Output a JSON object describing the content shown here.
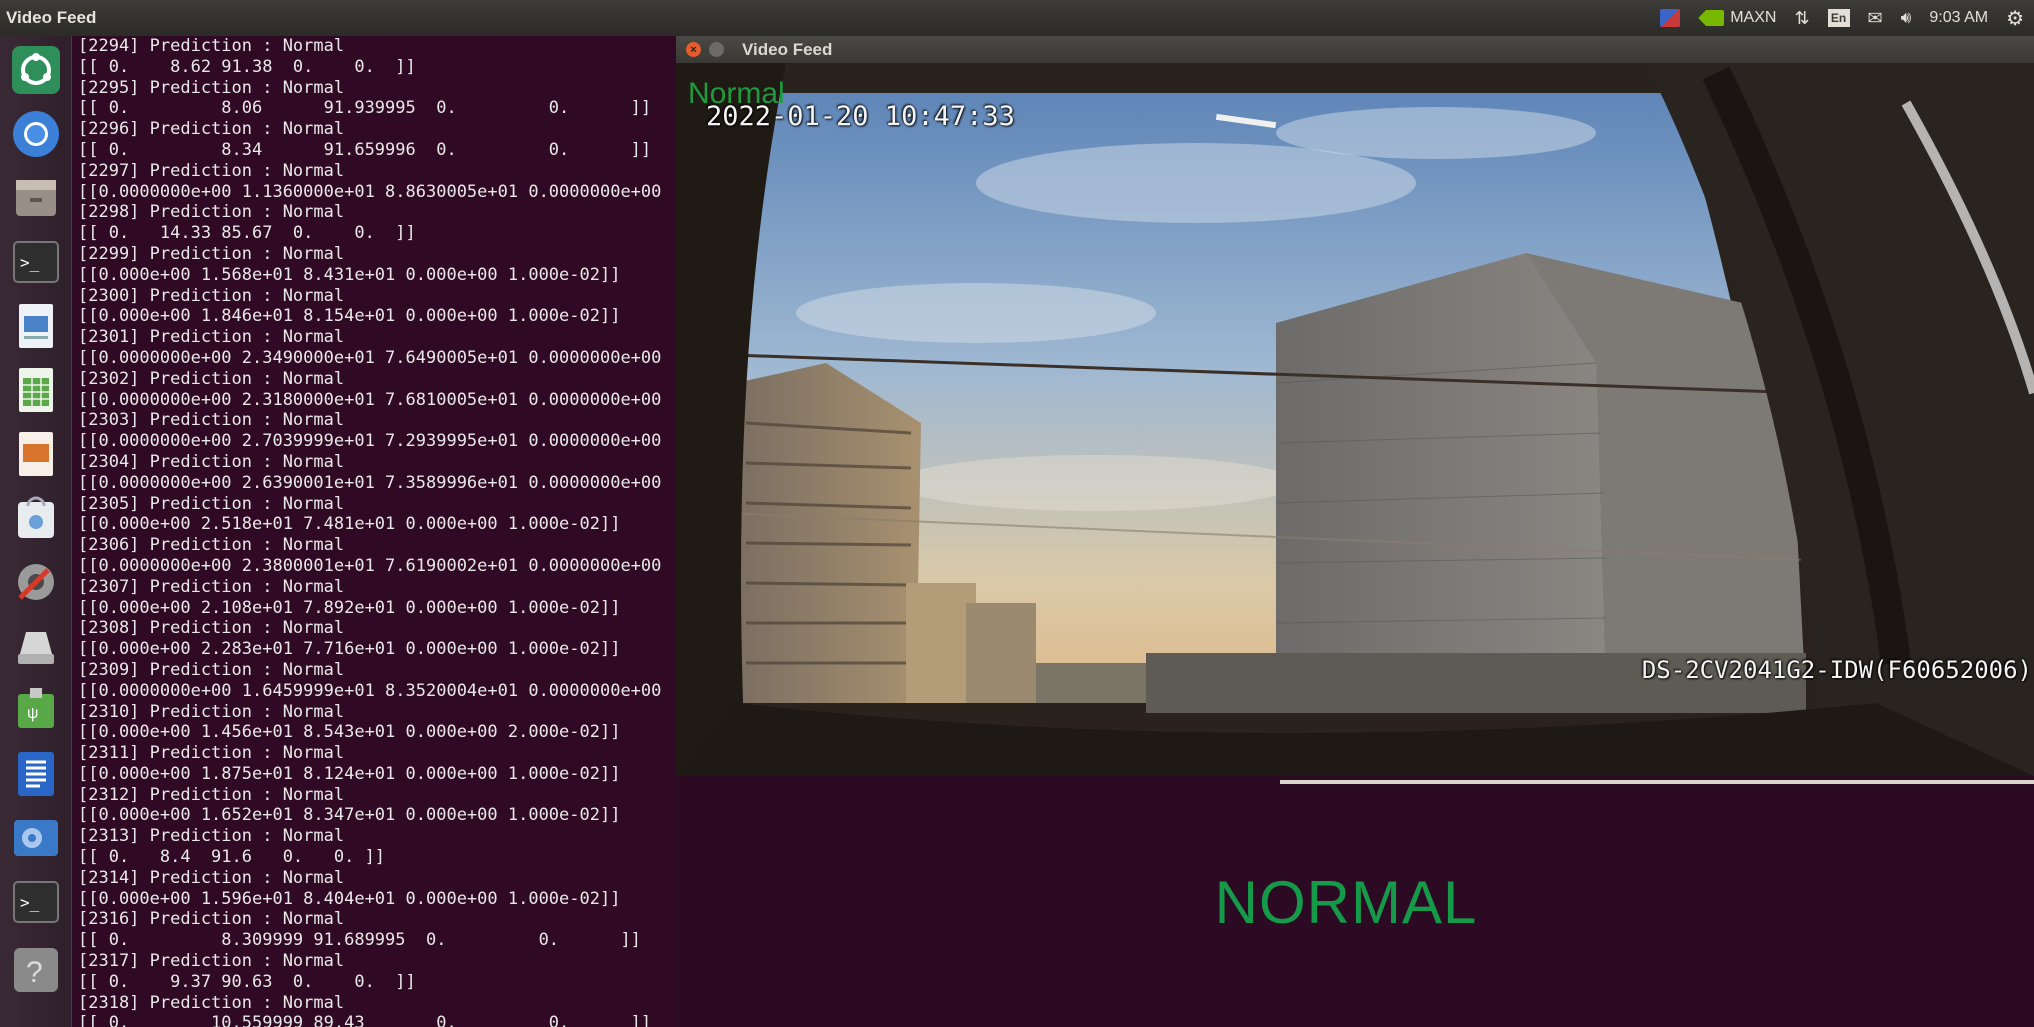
{
  "top_panel": {
    "title": "Video Feed",
    "indicators": {
      "power_mode": "MAXN",
      "keyboard_layout": "En",
      "clock": "9:03 AM"
    }
  },
  "launcher": {
    "items": [
      {
        "name": "ubuntu-dash-icon"
      },
      {
        "name": "chromium-icon"
      },
      {
        "name": "files-icon"
      },
      {
        "name": "terminal-icon"
      },
      {
        "name": "document-viewer-icon"
      },
      {
        "name": "spreadsheet-icon"
      },
      {
        "name": "presentation-icon"
      },
      {
        "name": "software-center-icon"
      },
      {
        "name": "system-settings-icon"
      },
      {
        "name": "drive-icon"
      },
      {
        "name": "usb-drive-icon"
      },
      {
        "name": "text-editor-icon"
      },
      {
        "name": "video-player-icon"
      },
      {
        "name": "terminal-icon-2"
      },
      {
        "name": "help-icon"
      }
    ]
  },
  "terminal": {
    "lines": [
      "[2294] Prediction : Normal",
      "[[ 0.    8.62 91.38  0.    0.  ]]",
      "[2295] Prediction : Normal",
      "[[ 0.         8.06      91.939995  0.         0.      ]]",
      "[2296] Prediction : Normal",
      "[[ 0.         8.34      91.659996  0.         0.      ]]",
      "[2297] Prediction : Normal",
      "[[0.0000000e+00 1.1360000e+01 8.8630005e+01 0.0000000e+00",
      "[2298] Prediction : Normal",
      "[[ 0.   14.33 85.67  0.    0.  ]]",
      "[2299] Prediction : Normal",
      "[[0.000e+00 1.568e+01 8.431e+01 0.000e+00 1.000e-02]]",
      "[2300] Prediction : Normal",
      "[[0.000e+00 1.846e+01 8.154e+01 0.000e+00 1.000e-02]]",
      "[2301] Prediction : Normal",
      "[[0.0000000e+00 2.3490000e+01 7.6490005e+01 0.0000000e+00",
      "[2302] Prediction : Normal",
      "[[0.0000000e+00 2.3180000e+01 7.6810005e+01 0.0000000e+00",
      "[2303] Prediction : Normal",
      "[[0.0000000e+00 2.7039999e+01 7.2939995e+01 0.0000000e+00",
      "[2304] Prediction : Normal",
      "[[0.0000000e+00 2.6390001e+01 7.3589996e+01 0.0000000e+00",
      "[2305] Prediction : Normal",
      "[[0.000e+00 2.518e+01 7.481e+01 0.000e+00 1.000e-02]]",
      "[2306] Prediction : Normal",
      "[[0.0000000e+00 2.3800001e+01 7.6190002e+01 0.0000000e+00",
      "[2307] Prediction : Normal",
      "[[0.000e+00 2.108e+01 7.892e+01 0.000e+00 1.000e-02]]",
      "[2308] Prediction : Normal",
      "[[0.000e+00 2.283e+01 7.716e+01 0.000e+00 1.000e-02]]",
      "[2309] Prediction : Normal",
      "[[0.0000000e+00 1.6459999e+01 8.3520004e+01 0.0000000e+00",
      "[2310] Prediction : Normal",
      "[[0.000e+00 1.456e+01 8.543e+01 0.000e+00 2.000e-02]]",
      "[2311] Prediction : Normal",
      "[[0.000e+00 1.875e+01 8.124e+01 0.000e+00 1.000e-02]]",
      "[2312] Prediction : Normal",
      "[[0.000e+00 1.652e+01 8.347e+01 0.000e+00 1.000e-02]]",
      "[2313] Prediction : Normal",
      "[[ 0.   8.4  91.6   0.   0. ]]",
      "[2314] Prediction : Normal",
      "[[0.000e+00 1.596e+01 8.404e+01 0.000e+00 1.000e-02]]",
      "[2316] Prediction : Normal",
      "[[ 0.         8.309999 91.689995  0.         0.      ]]",
      "[2317] Prediction : Normal",
      "[[ 0.    9.37 90.63  0.    0.  ]]",
      "[2318] Prediction : Normal",
      "[[ 0.        10.559999 89.43       0.         0.      ]]"
    ]
  },
  "video_window": {
    "title": "Video Feed",
    "osd_label": "Normal",
    "osd_timestamp": "2022-01-20 10:47:33",
    "osd_camera_id": "DS-2CV2041G2-IDW(F60652006)"
  },
  "status_pane": {
    "status": "NORMAL"
  },
  "colors": {
    "terminal_bg": "#300a24",
    "status_green": "#149a48",
    "osd_green": "#1f9a3e",
    "nvidia_green": "#76b900"
  }
}
